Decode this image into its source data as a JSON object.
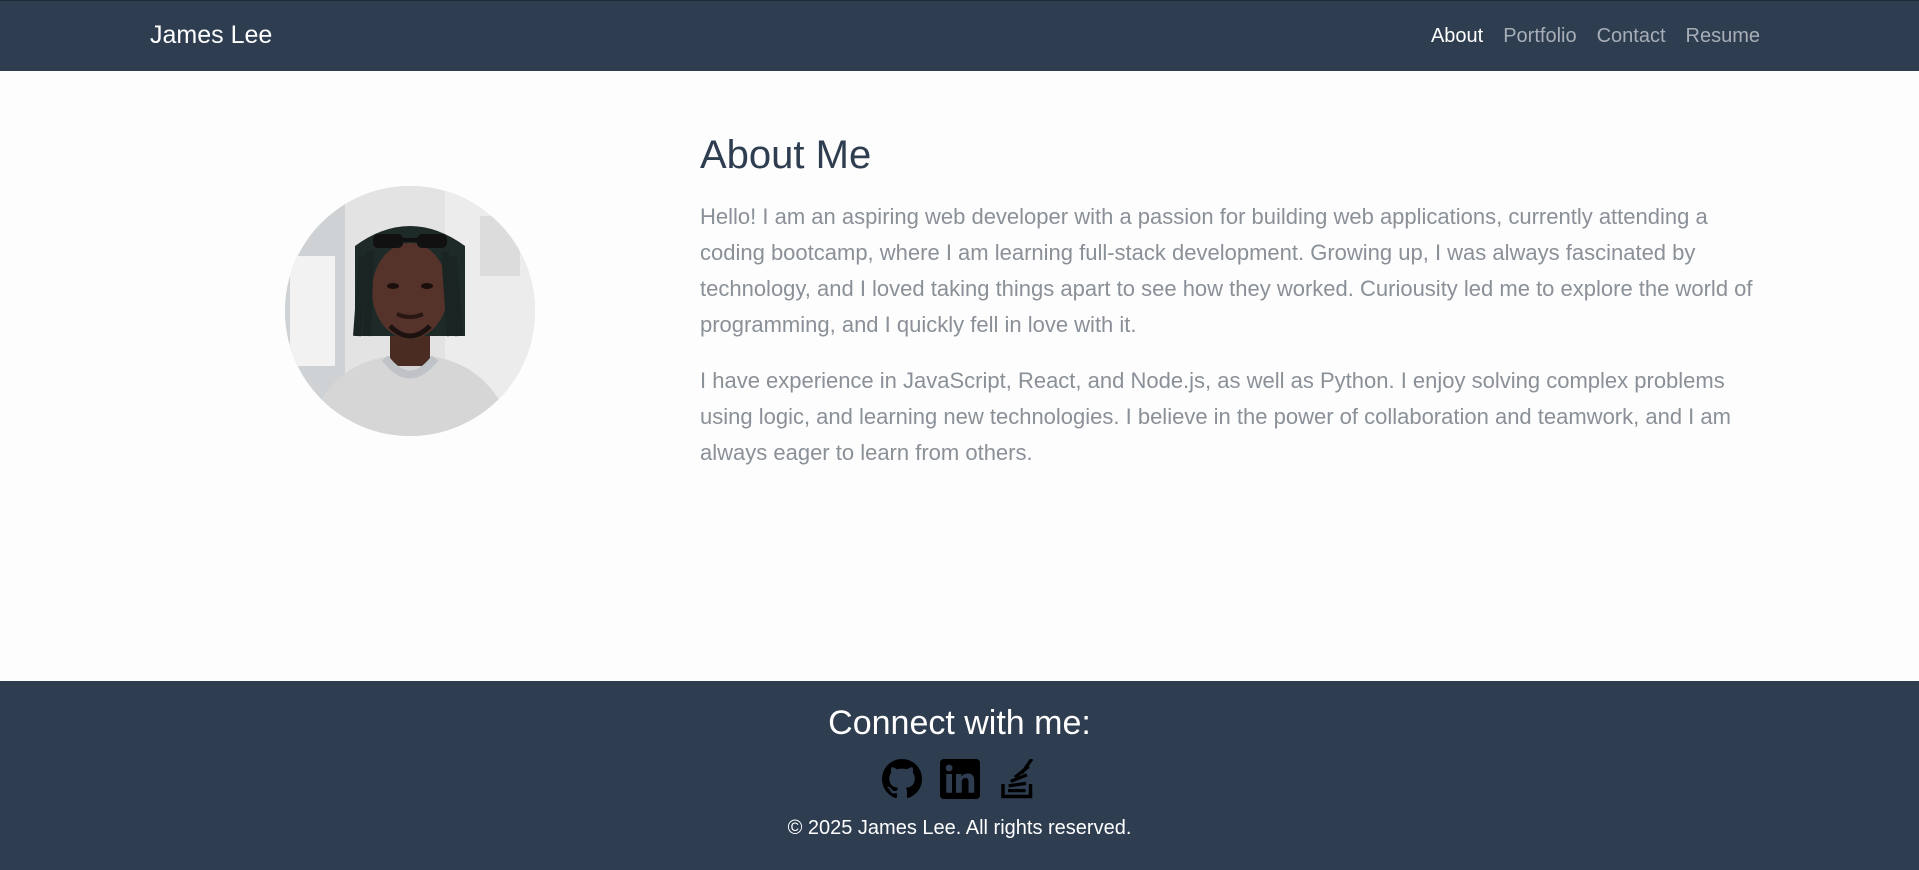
{
  "nav": {
    "brand": "James Lee",
    "links": [
      {
        "label": "About",
        "active": true
      },
      {
        "label": "Portfolio",
        "active": false
      },
      {
        "label": "Contact",
        "active": false
      },
      {
        "label": "Resume",
        "active": false
      }
    ]
  },
  "about": {
    "title": "About Me",
    "paragraphs": [
      "Hello! I am an aspiring web developer with a passion for building web applications, currently attending a coding bootcamp, where I am learning full-stack development. Growing up, I was always fascinated by technology, and I loved taking things apart to see how they worked. Curiousity led me to explore the world of programming, and I quickly fell in love with it.",
      "I have experience in JavaScript, React, and Node.js, as well as Python. I enjoy solving complex problems using logic, and learning new technologies. I believe in the power of collaboration and teamwork, and I am always eager to learn from others."
    ]
  },
  "footer": {
    "heading": "Connect with me:",
    "socials": [
      {
        "icon": "github-icon"
      },
      {
        "icon": "linkedin-icon"
      },
      {
        "icon": "stackoverflow-icon"
      }
    ],
    "copyright": "© 2025 James Lee. All rights reserved."
  },
  "colors": {
    "navbar": "#2e3d50",
    "text_muted": "#8a9097",
    "heading": "#2e3d50"
  }
}
